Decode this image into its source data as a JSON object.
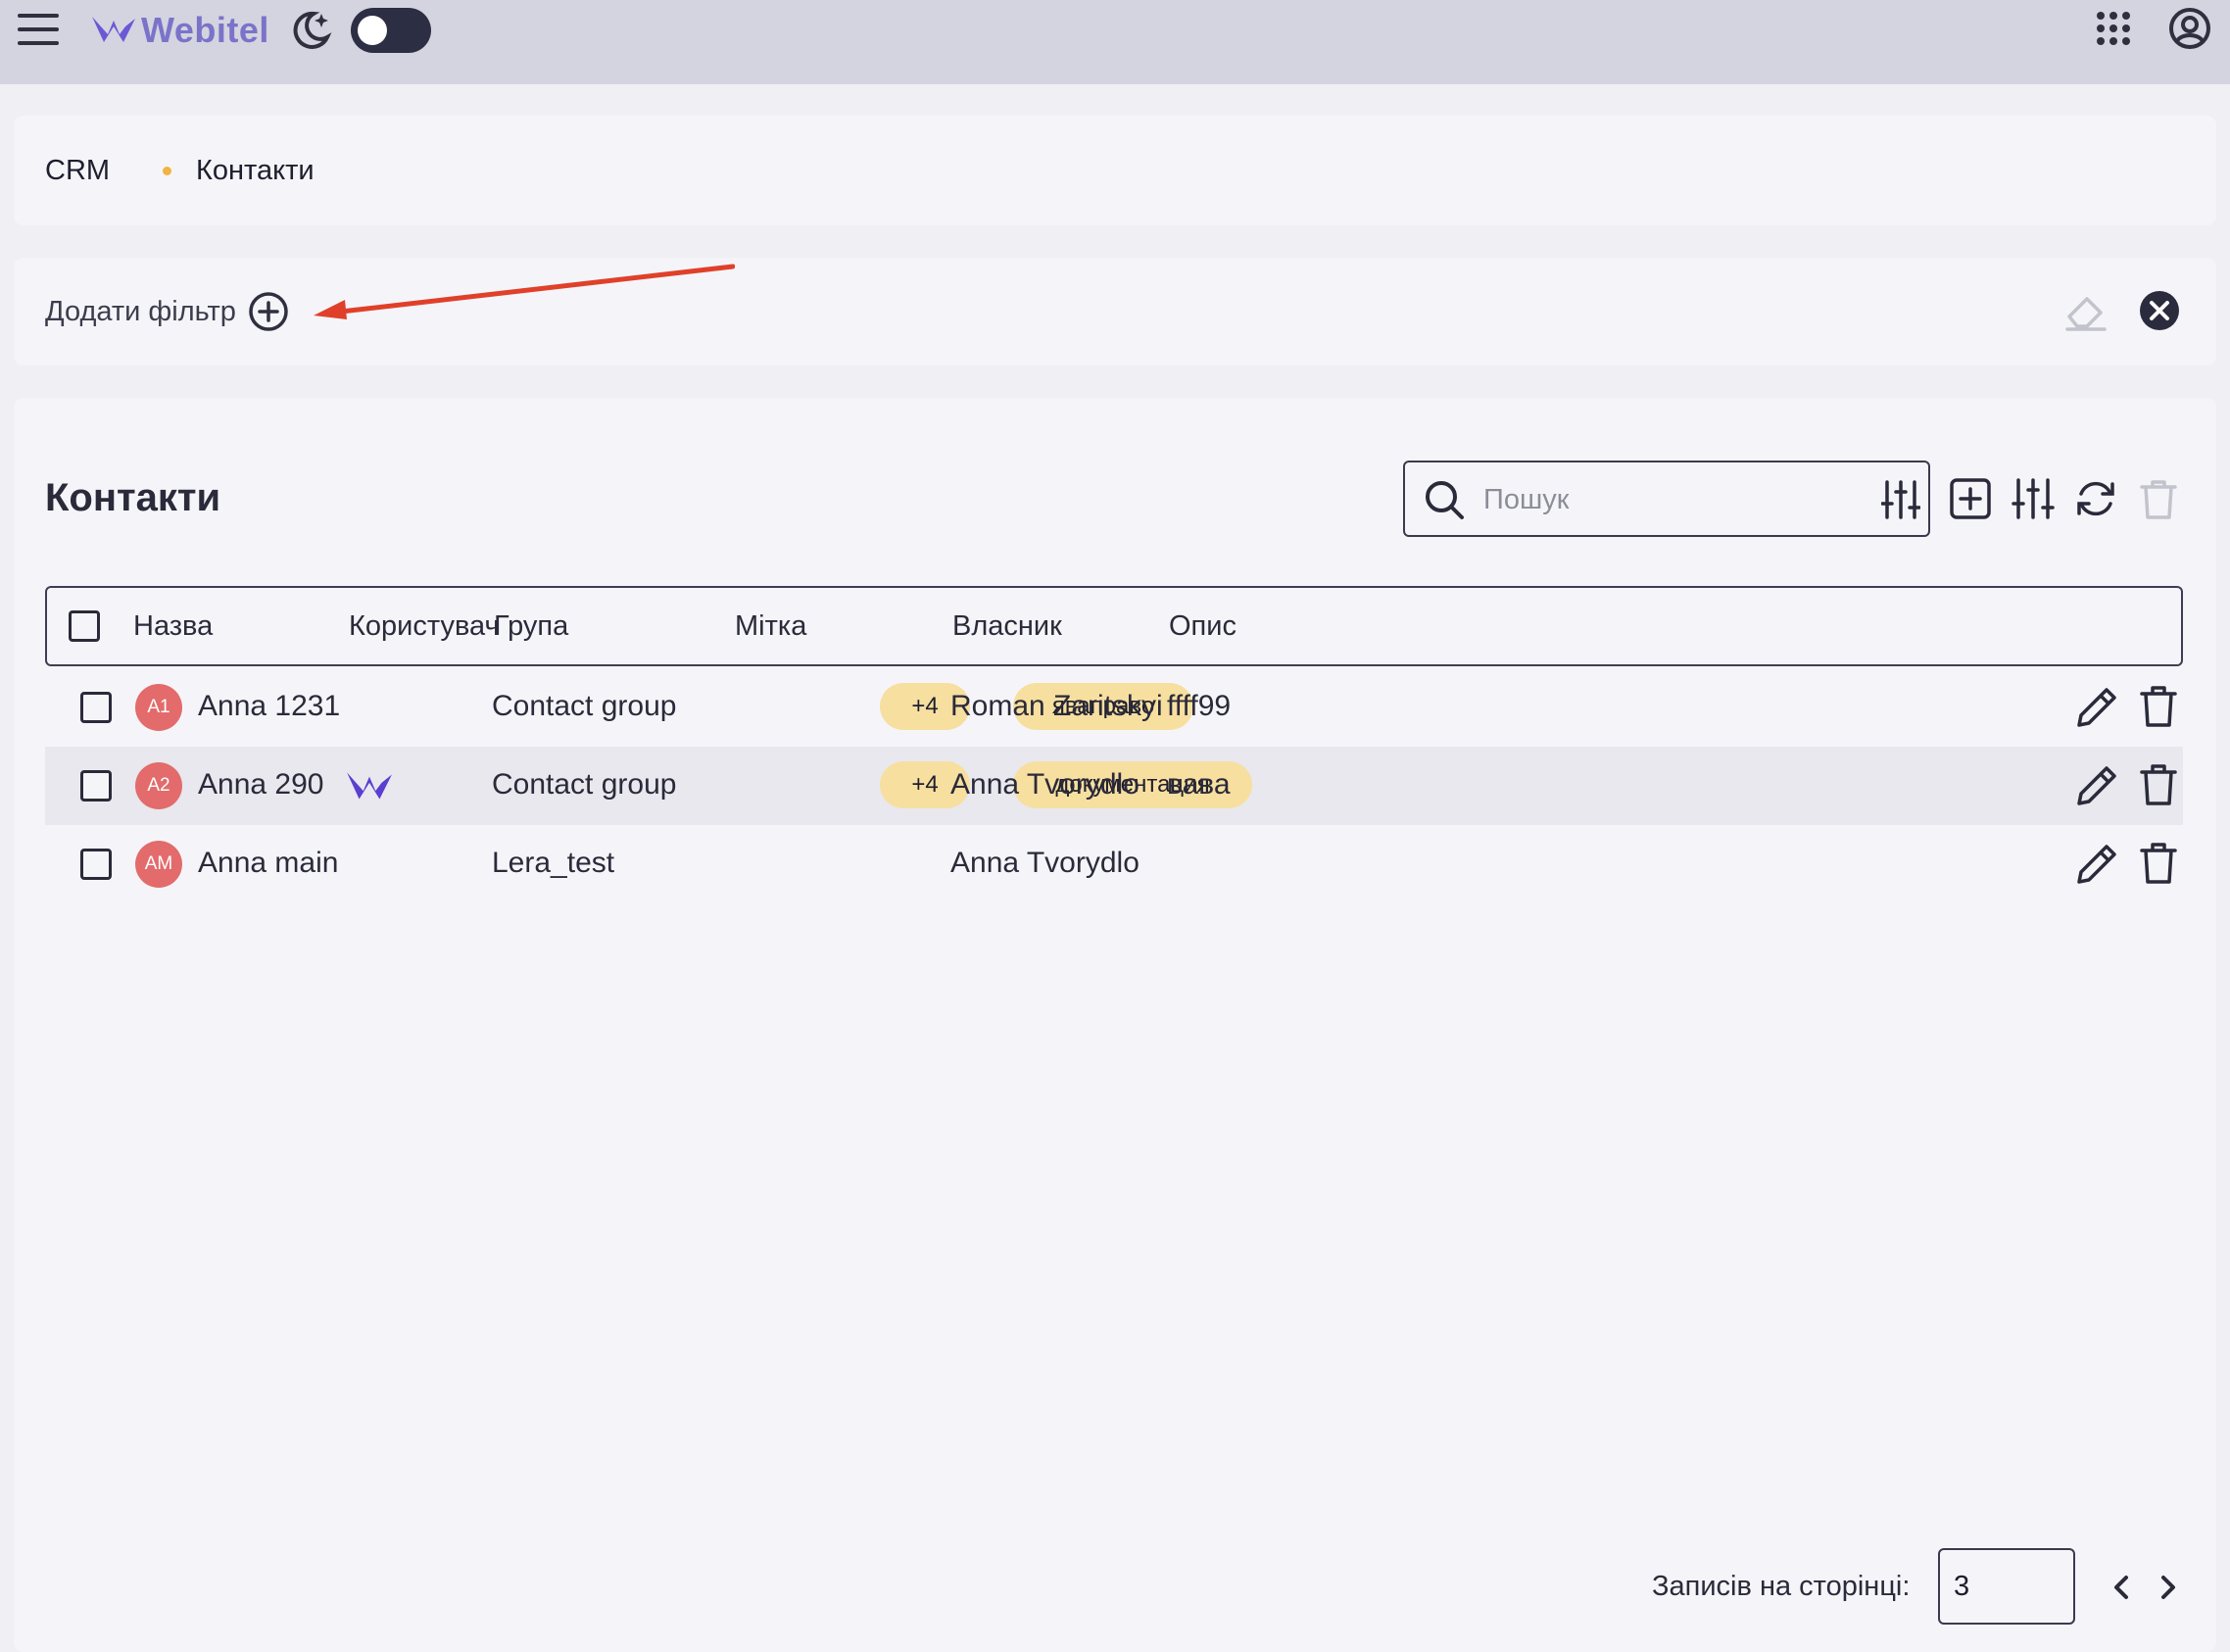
{
  "app": {
    "brand": "Webitel"
  },
  "breadcrumb": {
    "root": "CRM",
    "current": "Контакти"
  },
  "filters": {
    "add_label": "Додати фільтр"
  },
  "main": {
    "title": "Контакти",
    "search": {
      "placeholder": "Пошук",
      "value": ""
    },
    "columns": [
      "Назва",
      "Користувач",
      "Група",
      "Мітка",
      "Власник",
      "Опис"
    ],
    "rows": [
      {
        "initials": "A1",
        "name": "Anna 1231",
        "has_user": false,
        "group": "Contact group",
        "group_more": "+4",
        "label": "яваправо",
        "owner": "Roman Zaritskyi",
        "description": "ffff99"
      },
      {
        "initials": "A2",
        "name": "Anna 290",
        "has_user": true,
        "group": "Contact group",
        "group_more": "+4",
        "label": "документация",
        "owner": "Anna Tvorydlo",
        "description": "вава"
      },
      {
        "initials": "AM",
        "name": "Anna main",
        "has_user": false,
        "group": "Lera_test",
        "group_more": "",
        "label": "",
        "owner": "Anna Tvorydlo",
        "description": ""
      }
    ]
  },
  "pagination": {
    "label": "Записів на сторінці:",
    "per_page": "3"
  },
  "colors": {
    "accent": "#7b73c9",
    "avatar": "#e36b6b",
    "chip": "#f7dfa0",
    "annotation_arrow": "#e0402a"
  },
  "icons": [
    "menu-icon",
    "theme-moon-icon",
    "apps-grid-icon",
    "account-icon",
    "add-circle-icon",
    "eraser-icon",
    "close-circle-icon",
    "search-icon",
    "filter-settings-icon",
    "add-square-icon",
    "columns-settings-icon",
    "refresh-icon",
    "trash-icon",
    "edit-pencil-icon",
    "chevron-left-icon",
    "chevron-right-icon"
  ]
}
